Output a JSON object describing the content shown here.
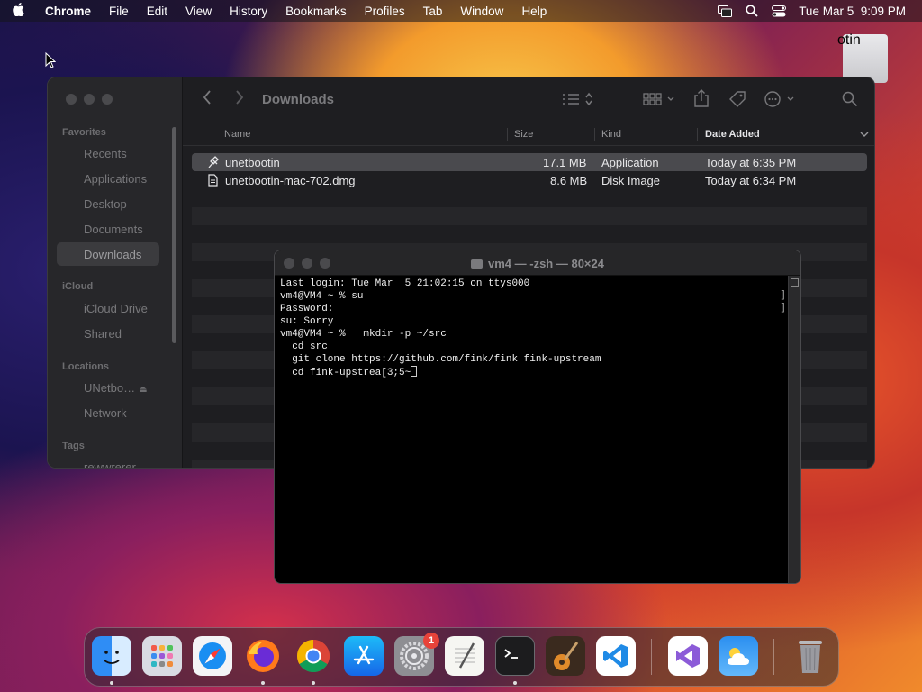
{
  "menubar": {
    "app_name": "Chrome",
    "items": [
      "File",
      "Edit",
      "View",
      "History",
      "Bookmarks",
      "Profiles",
      "Tab",
      "Window",
      "Help"
    ],
    "clock": "Tue Mar 5  9:09 PM"
  },
  "desktop": {
    "drive_label": "otin"
  },
  "finder": {
    "title": "Downloads",
    "sidebar": {
      "favorites_header": "Favorites",
      "favorites": [
        "Recents",
        "Applications",
        "Desktop",
        "Documents",
        "Downloads"
      ],
      "selected": "Downloads",
      "icloud_header": "iCloud",
      "icloud": [
        "iCloud Drive",
        "Shared"
      ],
      "locations_header": "Locations",
      "locations": [
        "UNetbo…",
        "Network"
      ],
      "tags_header": "Tags",
      "tags": [
        "rewwrerer"
      ]
    },
    "columns": {
      "name": "Name",
      "size": "Size",
      "kind": "Kind",
      "date_added": "Date Added"
    },
    "files": [
      {
        "name": "unetbootin",
        "size": "17.1 MB",
        "kind": "Application",
        "date_added": "Today at 6:35 PM"
      },
      {
        "name": "unetbootin-mac-702.dmg",
        "size": "8.6 MB",
        "kind": "Disk Image",
        "date_added": "Today at 6:34 PM"
      }
    ]
  },
  "terminal": {
    "title": "vm4 — -zsh — 80×24",
    "lines": [
      "Last login: Tue Mar  5 21:02:15 on ttys000",
      "vm4@VM4 ~ % su",
      "Password:",
      "su: Sorry",
      "vm4@VM4 ~ %   mkdir -p ~/src",
      "  cd src",
      "  git clone https://github.com/fink/fink fink-upstream",
      "  cd fink-upstrea[3;5~"
    ]
  },
  "dock": {
    "apps": [
      "Finder",
      "Launchpad",
      "Safari",
      "Firefox",
      "Chrome",
      "App Store",
      "System Settings",
      "TextEdit",
      "Terminal",
      "GarageBand",
      "Visual Studio Code",
      "Visual Studio",
      "Weather",
      "Trash"
    ],
    "settings_badge": "1"
  }
}
